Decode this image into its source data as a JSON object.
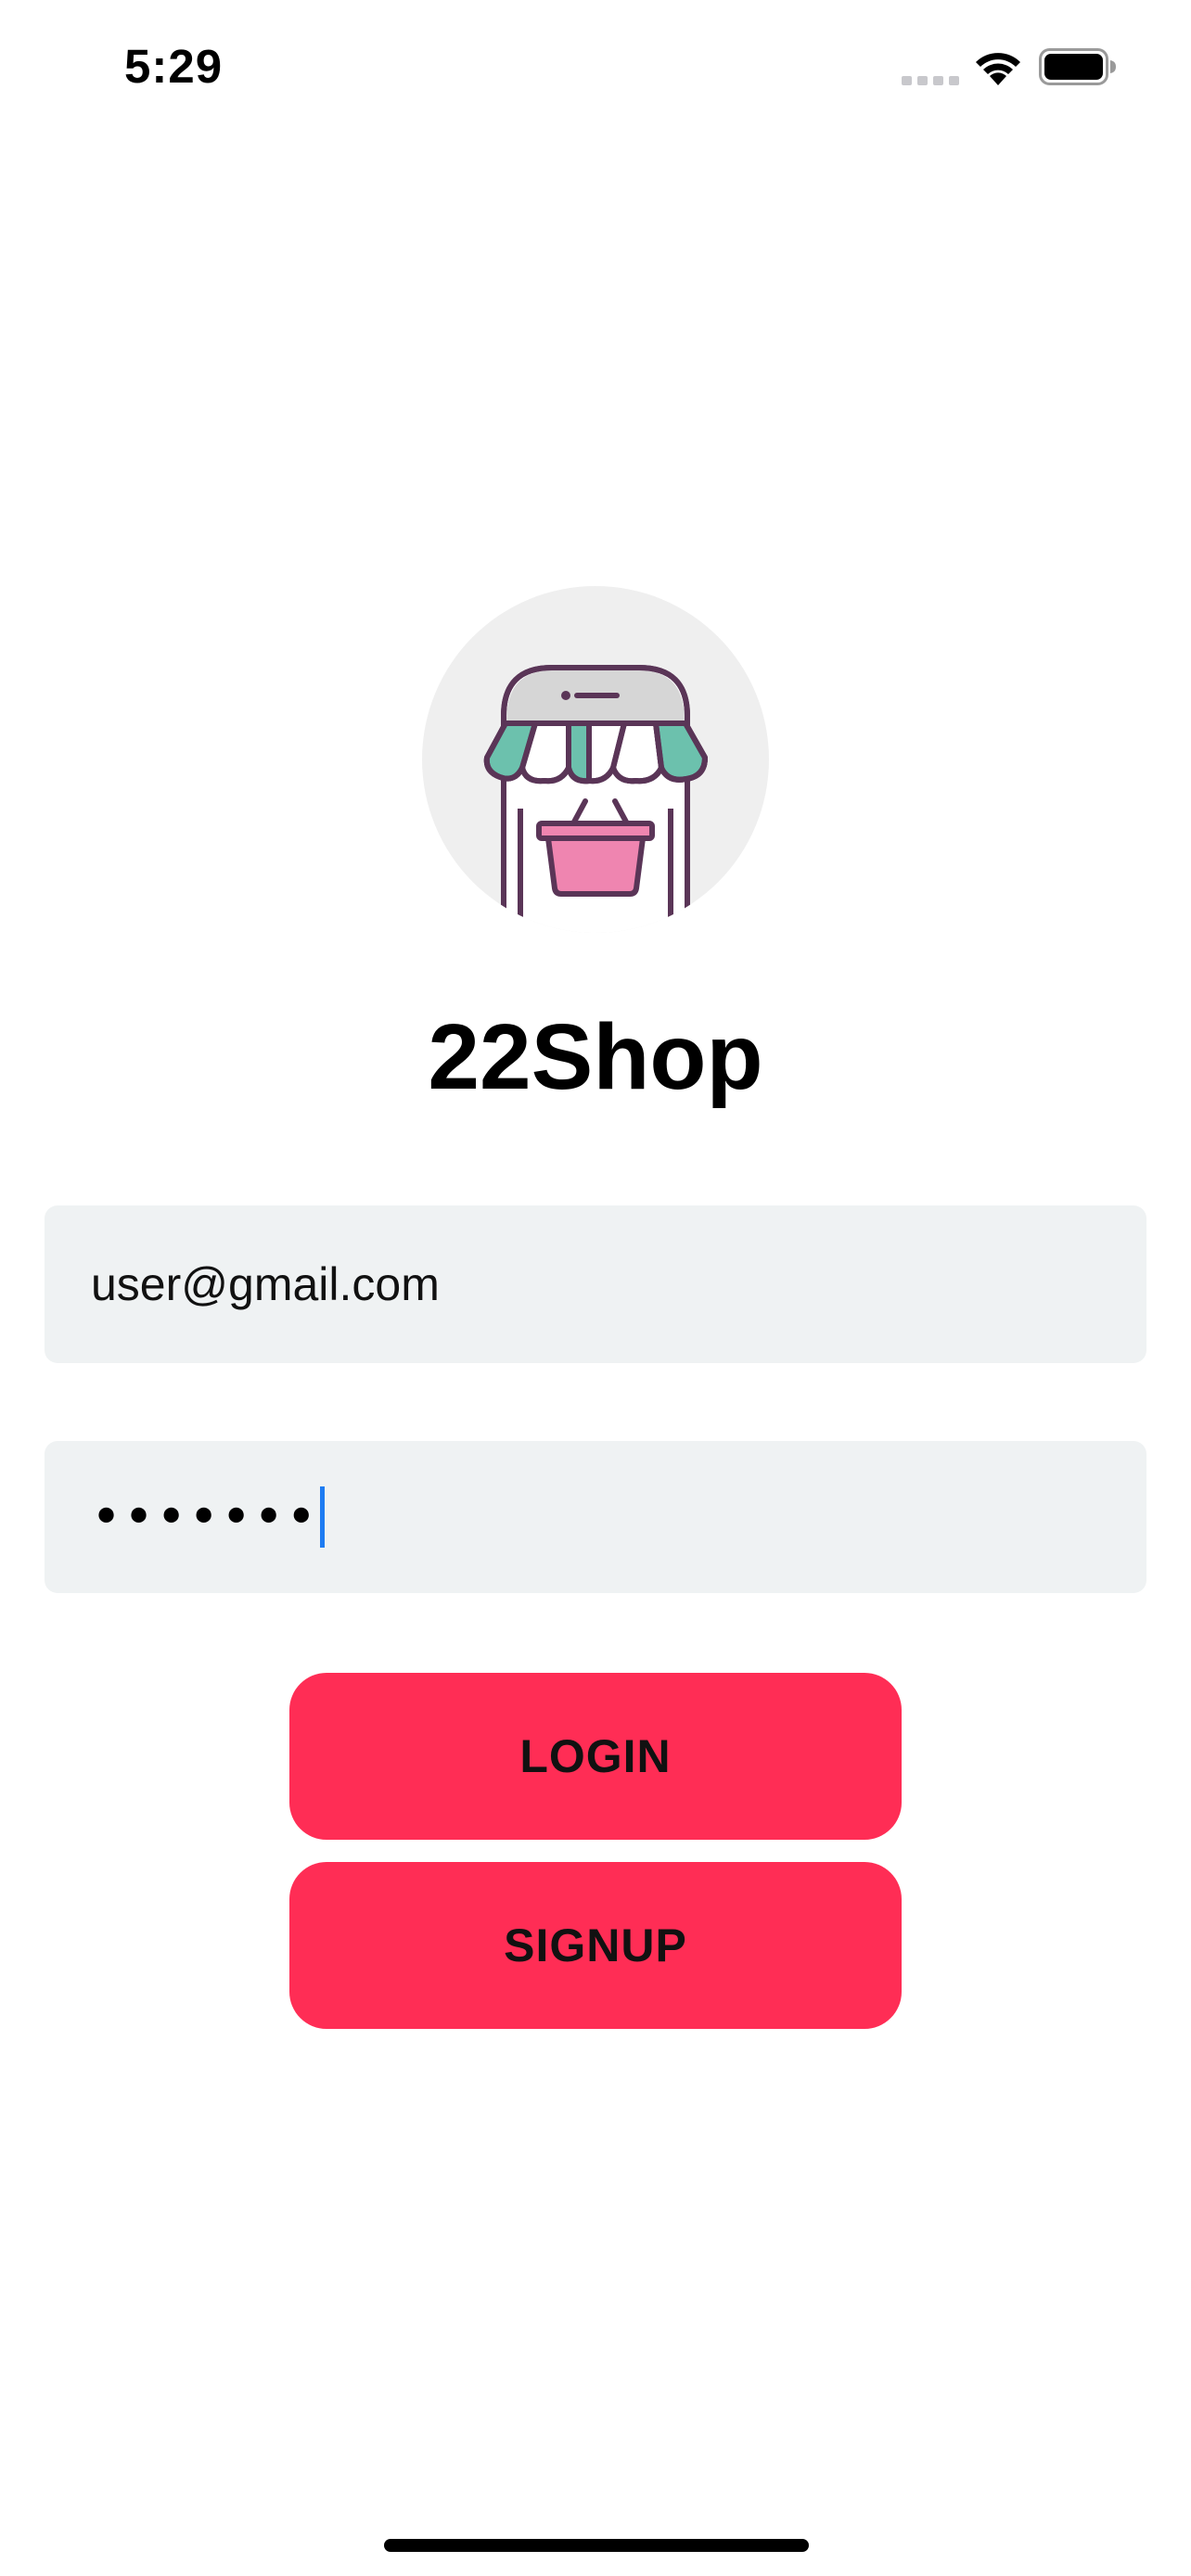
{
  "status_bar": {
    "time": "5:29"
  },
  "app": {
    "title": "22Shop",
    "logo_icon": "storefront-basket-icon"
  },
  "login_form": {
    "email": {
      "value": "user@gmail.com"
    },
    "password": {
      "masked_value": "•••••••"
    },
    "login_label": "LOGIN",
    "signup_label": "SIGNUP"
  },
  "colors": {
    "accent": "#ff2d55",
    "field_background": "#eff2f3",
    "caret": "#1e7cf2"
  }
}
